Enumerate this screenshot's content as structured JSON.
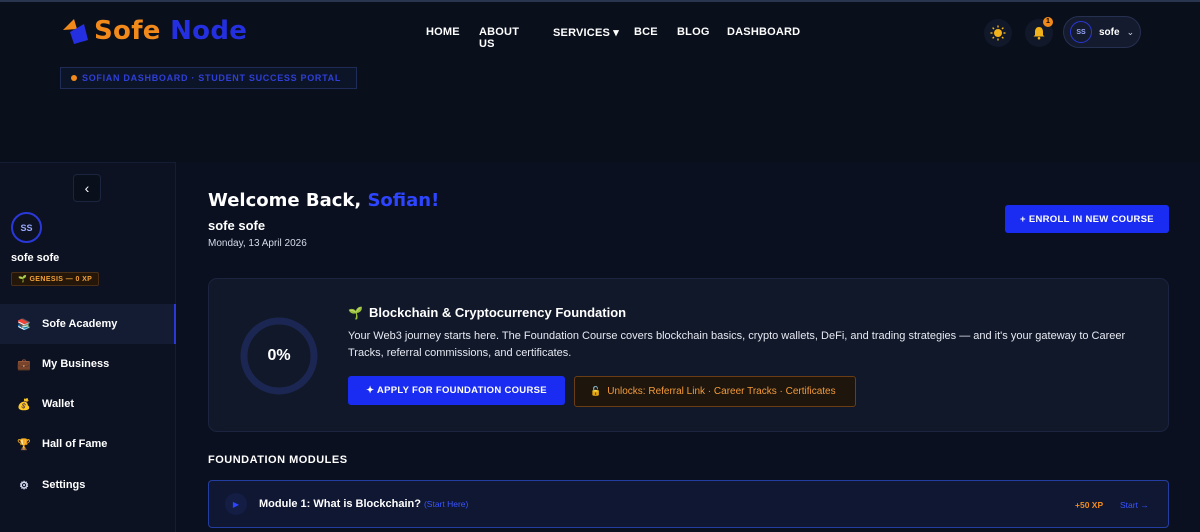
{
  "brand": {
    "name_part1": "Sofe",
    "name_part2": "Node",
    "accent_orange": "#f28a1b",
    "accent_blue": "#2430e0"
  },
  "nav": {
    "home": "HOME",
    "about": "ABOUT US",
    "services": "SERVICES ▾",
    "bce": "BCE",
    "blog": "BLOG",
    "dashboard": "DASHBOARD"
  },
  "header": {
    "theme_icon": "sun-icon",
    "notifications_icon": "bell-icon",
    "notification_count": "1",
    "user_initials": "SS",
    "user_name": "sofe",
    "user_chevron": "⌄"
  },
  "portal_tag": "SOFIAN DASHBOARD · STUDENT SUCCESS PORTAL",
  "sidebar": {
    "collapse_label": "‹",
    "initials": "SS",
    "name": "sofe sofe",
    "xp_badge": "🌱 GENESIS — 0 XP",
    "items": [
      {
        "label": "Sofe Academy",
        "icon": "books-icon",
        "glyph": "📚",
        "active": true
      },
      {
        "label": "My Business",
        "icon": "briefcase-icon",
        "glyph": "💼",
        "active": false
      },
      {
        "label": "Wallet",
        "icon": "money-bag-icon",
        "glyph": "💰",
        "active": false
      },
      {
        "label": "Hall of Fame",
        "icon": "trophy-icon",
        "glyph": "🏆",
        "active": false
      },
      {
        "label": "Settings",
        "icon": "gear-icon",
        "glyph": "⚙",
        "active": false
      }
    ]
  },
  "main": {
    "welcome_prefix": "Welcome Back, ",
    "welcome_name": "Sofian!",
    "full_name": "sofe sofe",
    "date": "Monday, 13 April 2026",
    "enroll_button": "+ ENROLL IN NEW COURSE",
    "course": {
      "progress_percent": 0,
      "progress_label": "0%",
      "title_icon": "🌱",
      "title": "Blockchain & Cryptocurrency Foundation",
      "description": "Your Web3 journey starts here. The Foundation Course covers blockchain basics, crypto wallets, DeFi, and trading strategies — and it's your gateway to Career Tracks, referral commissions, and certificates.",
      "apply_button": "✦ APPLY FOR FOUNDATION COURSE",
      "unlocks_icon": "🔓",
      "unlocks": "Unlocks: Referral Link · Career Tracks · Certificates"
    },
    "modules_heading": "FOUNDATION MODULES",
    "modules": [
      {
        "title": "Module 1: What is Blockchain?",
        "hint": "(Start Here)",
        "xp": "+50 XP",
        "action": "Start →"
      }
    ]
  }
}
